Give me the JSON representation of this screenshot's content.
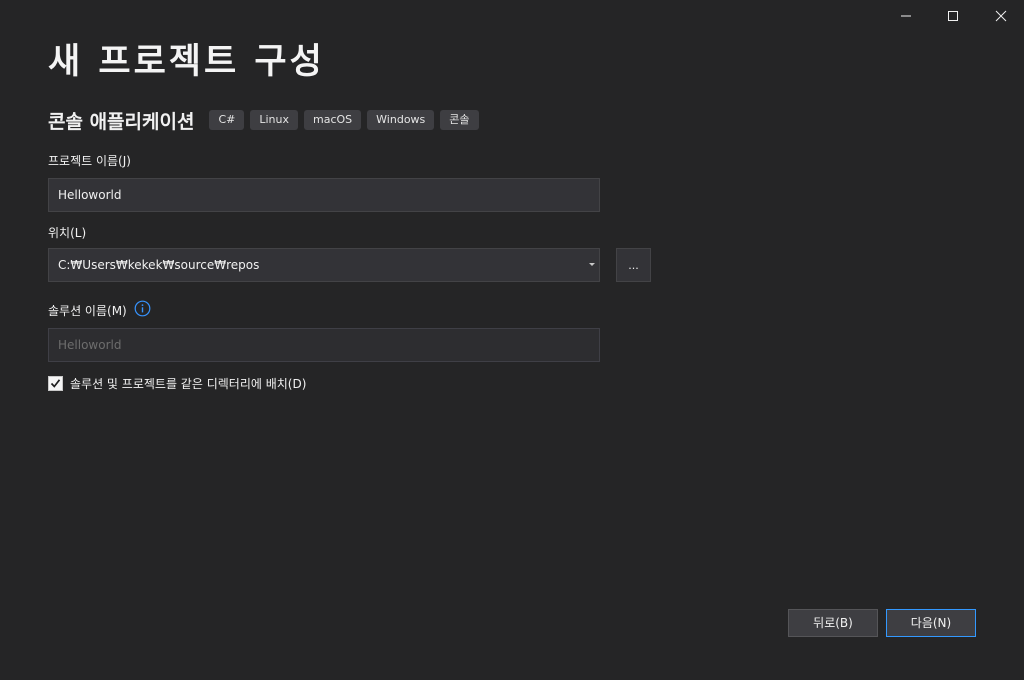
{
  "page_title": "새 프로젝트 구성",
  "template": {
    "name": "콘솔 애플리케이션",
    "tags": [
      "C#",
      "Linux",
      "macOS",
      "Windows",
      "콘솔"
    ]
  },
  "project_name": {
    "label": "프로젝트 이름(J)",
    "value": "Helloworld"
  },
  "location": {
    "label": "위치(L)",
    "value": "C:₩Users₩kekek₩source₩repos",
    "browse_label": "..."
  },
  "solution_name": {
    "label": "솔루션 이름(M)",
    "value": "Helloworld"
  },
  "same_directory": {
    "label": "솔루션 및 프로젝트를 같은 디렉터리에 배치(D)",
    "checked": true
  },
  "buttons": {
    "back": "뒤로(B)",
    "next": "다음(N)"
  },
  "colors": {
    "background": "#252526",
    "accent": "#3399ff",
    "info_icon": "#3794ff"
  },
  "icons": {
    "minimize": "minimize-icon",
    "maximize": "maximize-icon",
    "close": "close-icon",
    "info": "info-icon",
    "checkmark": "checkmark-icon",
    "dropdown": "chevron-down-icon"
  }
}
